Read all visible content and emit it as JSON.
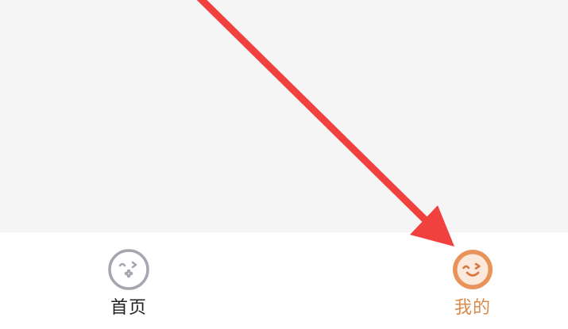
{
  "tab_bar": {
    "tabs": [
      {
        "label": "首页",
        "icon": "home-face-icon",
        "active": false
      },
      {
        "label": "我的",
        "icon": "wink-face-icon",
        "active": true
      }
    ],
    "colors": {
      "active": "#d98a4a",
      "active_icon": "#e8935a",
      "inactive_icon": "#a6a6b0",
      "inactive_text": "#222222"
    }
  },
  "annotation": {
    "type": "arrow",
    "color": "#f0413f",
    "points_to": "tab-mine"
  }
}
